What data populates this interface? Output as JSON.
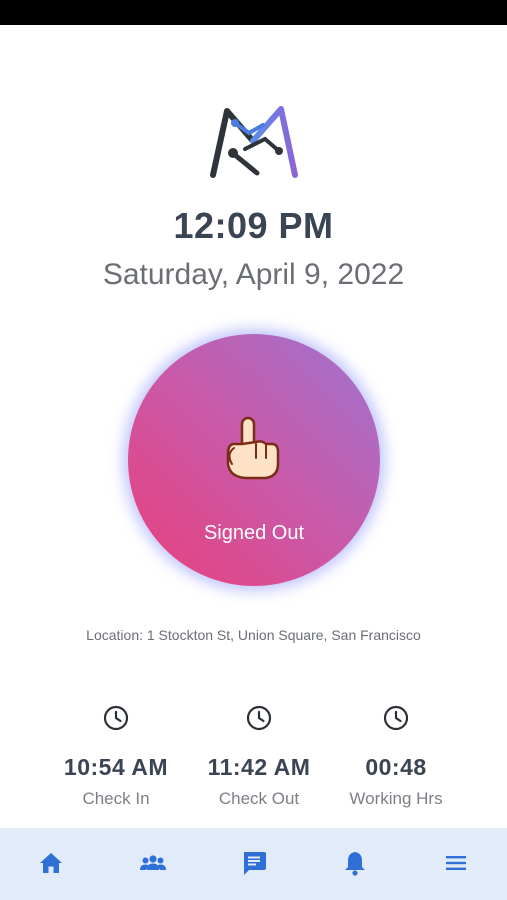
{
  "clock": {
    "time": "12:09 PM",
    "date": "Saturday, April 9, 2022"
  },
  "sign_button": {
    "status_label": "Signed Out",
    "icon": "pointing-hand-icon",
    "gradient_colors": [
      "#9d74d0",
      "#c65cac",
      "#ea3f7c"
    ]
  },
  "location": {
    "text": "Location: 1 Stockton St, Union Square, San Francisco"
  },
  "stats": [
    {
      "icon": "clock-icon",
      "value": "10:54 AM",
      "label": "Check In"
    },
    {
      "icon": "clock-icon",
      "value": "11:42 AM",
      "label": "Check Out"
    },
    {
      "icon": "clock-icon",
      "value": "00:48",
      "label": "Working Hrs"
    }
  ],
  "tab_bar": {
    "items": [
      {
        "icon": "home-icon"
      },
      {
        "icon": "team-icon"
      },
      {
        "icon": "chat-icon"
      },
      {
        "icon": "bell-icon"
      },
      {
        "icon": "menu-icon"
      }
    ],
    "accent_color": "#2f6fd6",
    "background_color": "#e1ebf9"
  },
  "colors": {
    "text_primary": "#3a4453",
    "text_secondary": "#6b6f75"
  }
}
